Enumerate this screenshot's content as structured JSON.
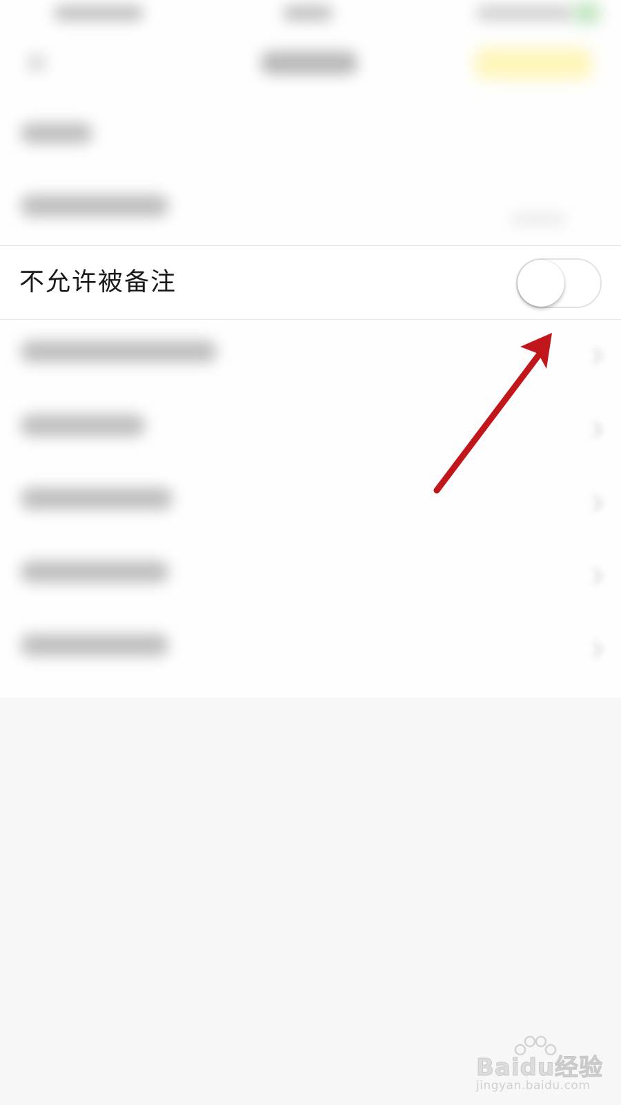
{
  "setting_row": {
    "label": "不允许被备注",
    "toggle_checked": false
  },
  "annotation": {
    "arrow_color": "#c0161c"
  },
  "watermark": {
    "brand": "Baidu经验",
    "url": "jingyan.baidu.com"
  },
  "colors": {
    "background": "#f7f7f7",
    "row_background": "#ffffff",
    "toggle_off_track": "#ffffff",
    "divider": "#e6e6e6"
  }
}
